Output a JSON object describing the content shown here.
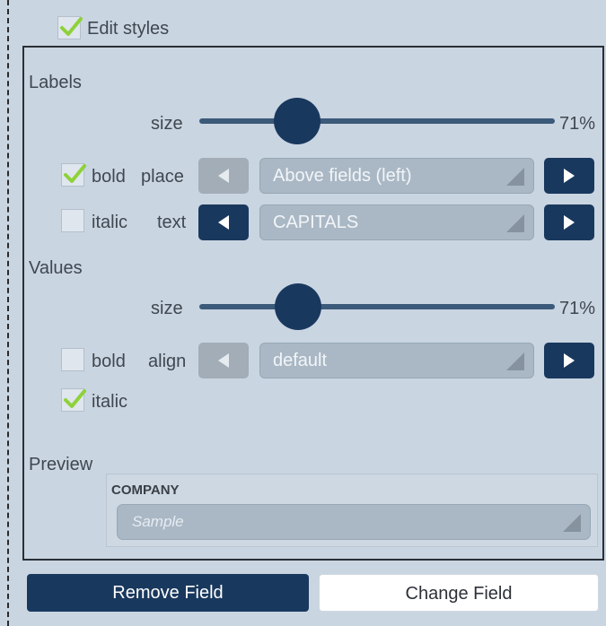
{
  "edit_styles": {
    "label": "Edit styles",
    "checked": true
  },
  "labels_section": {
    "heading": "Labels",
    "size_label": "size",
    "size_value": "71%",
    "size_fraction": 0.71,
    "bold_label": "bold",
    "bold_checked": true,
    "place_label": "place",
    "place_value": "Above fields (left)",
    "italic_label": "italic",
    "italic_checked": false,
    "text_label": "text",
    "text_value": "CAPITALS"
  },
  "values_section": {
    "heading": "Values",
    "size_label": "size",
    "size_value": "71%",
    "size_fraction": 0.71,
    "bold_label": "bold",
    "bold_checked": false,
    "align_label": "align",
    "align_value": "default",
    "italic_label": "italic",
    "italic_checked": true
  },
  "preview": {
    "heading": "Preview",
    "field_label": "COMPANY",
    "field_value": "Sample"
  },
  "buttons": {
    "remove": "Remove Field",
    "change": "Change Field"
  },
  "colors": {
    "panel_bg": "#c9d5e1",
    "accent_dark": "#19385e",
    "check_green": "#8fd13a",
    "select_bg": "#aab8c5"
  }
}
